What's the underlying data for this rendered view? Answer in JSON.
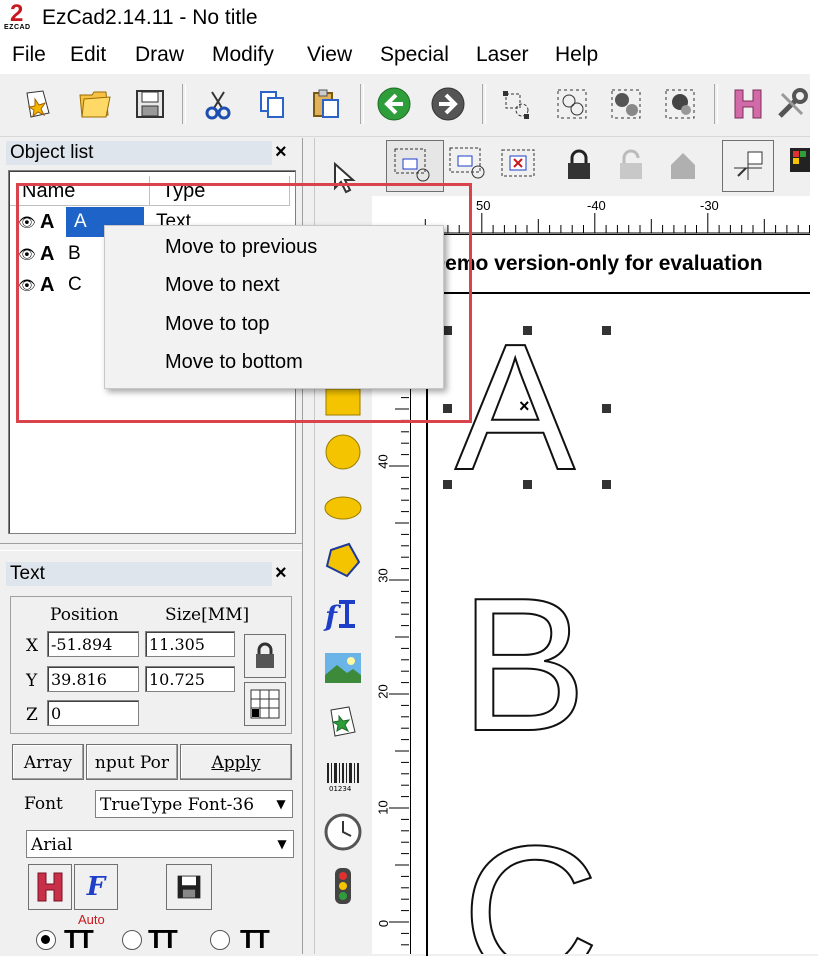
{
  "window": {
    "title": "EzCad2.14.11 - No title",
    "logo_text": "EZCAD",
    "logo_number": "2"
  },
  "menu": [
    {
      "label": "File"
    },
    {
      "label": "Edit"
    },
    {
      "label": "Draw"
    },
    {
      "label": "Modify"
    },
    {
      "label": "View"
    },
    {
      "label": "Special"
    },
    {
      "label": "Laser"
    },
    {
      "label": "Help"
    }
  ],
  "object_list": {
    "title": "Object list",
    "close_label": "×",
    "columns": [
      "Name",
      "Type"
    ],
    "rows": [
      {
        "name": "A",
        "type": "Text",
        "selected": true
      },
      {
        "name": "B",
        "type": ""
      },
      {
        "name": "C",
        "type": ""
      }
    ]
  },
  "context_menu": {
    "items": [
      "Move to previous",
      "Move to next",
      "Move to top",
      "Move to bottom"
    ]
  },
  "text_panel": {
    "title": "Text",
    "close_label": "×",
    "position_label": "Position",
    "size_label": "Size[MM]",
    "x_label": "X",
    "y_label": "Y",
    "z_label": "Z",
    "x_value": "-51.894",
    "y_value": "39.816",
    "z_value": "0",
    "size_x_value": "11.305",
    "size_y_value": "10.725",
    "array_button": "Array",
    "input_port_button": "nput Por",
    "apply_button": "Apply",
    "font_label": "Font",
    "font_type": "TrueType Font-36",
    "font_name": "Arial",
    "auto_label": "Auto"
  },
  "canvas": {
    "demo_banner": "Demo version-only for evaluation",
    "ruler_top": [
      "50",
      "-40",
      "-30"
    ],
    "ruler_left": [
      "40",
      "30",
      "20",
      "10",
      "0"
    ],
    "letters": [
      "A",
      "B",
      "C"
    ]
  },
  "colors": {
    "highlight": "#d9434b",
    "selection": "#1e64c8",
    "accent_green": "#2e9e3a"
  }
}
